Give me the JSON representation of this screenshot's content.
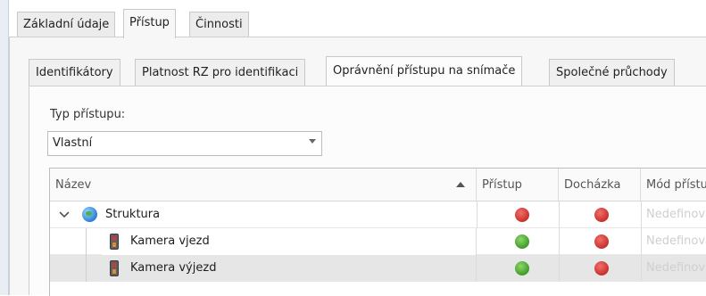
{
  "tabs": [
    "Základní údaje",
    "Přístup",
    "Činnosti"
  ],
  "active_tab": "Přístup",
  "subtabs": [
    "Identifikátory",
    "Platnost RZ pro identifikaci",
    "Oprávnění přístupu na snímače",
    "Společné průchody"
  ],
  "active_subtab": "Oprávnění přístupu na snímače",
  "access_type": {
    "label": "Typ přístupu:",
    "value": "Vlastní"
  },
  "grid": {
    "columns": [
      "Název",
      "Přístup",
      "Docházka",
      "Mód přístupu"
    ],
    "sort_column": "Název",
    "rows": [
      {
        "name": "Struktura",
        "icon": "globe-icon",
        "expanded": true,
        "access": "deny",
        "attendance": "deny",
        "mode": "Nedefinováno"
      },
      {
        "name": "Kamera vjezd",
        "icon": "camera-reader-icon",
        "access": "allow",
        "attendance": "deny",
        "mode": "Nedefinováno"
      },
      {
        "name": "Kamera výjezd",
        "icon": "camera-reader-icon",
        "access": "allow",
        "attendance": "deny",
        "mode": "Nedefinováno",
        "selected": true
      }
    ]
  },
  "colors": {
    "deny": "#c9302c",
    "allow": "#3e9c2a",
    "undefined_text": "#cfcfcf",
    "selected_row": "#e6e6e6"
  }
}
